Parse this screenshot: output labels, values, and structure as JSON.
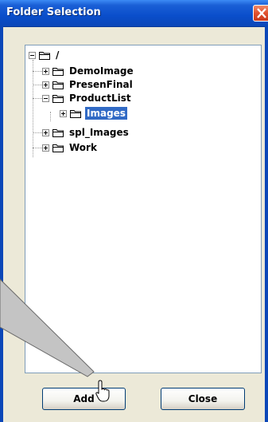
{
  "window": {
    "title": "Folder Selection"
  },
  "tree": {
    "root": {
      "label": "/",
      "expanded": true
    },
    "items": [
      {
        "label": "DemoImage",
        "expanded": false
      },
      {
        "label": "PresenFinal",
        "expanded": false
      },
      {
        "label": "ProductList",
        "expanded": true,
        "children": [
          {
            "label": "Images",
            "selected": true,
            "expanded": false
          }
        ]
      },
      {
        "label": "spl_Images",
        "expanded": false
      },
      {
        "label": "Work",
        "expanded": false
      }
    ]
  },
  "buttons": {
    "add_label": "Add",
    "close_label": "Close"
  },
  "colors": {
    "title_bar": "#0b47b8",
    "selection": "#316ac5",
    "dialog_bg": "#ece9d8"
  }
}
